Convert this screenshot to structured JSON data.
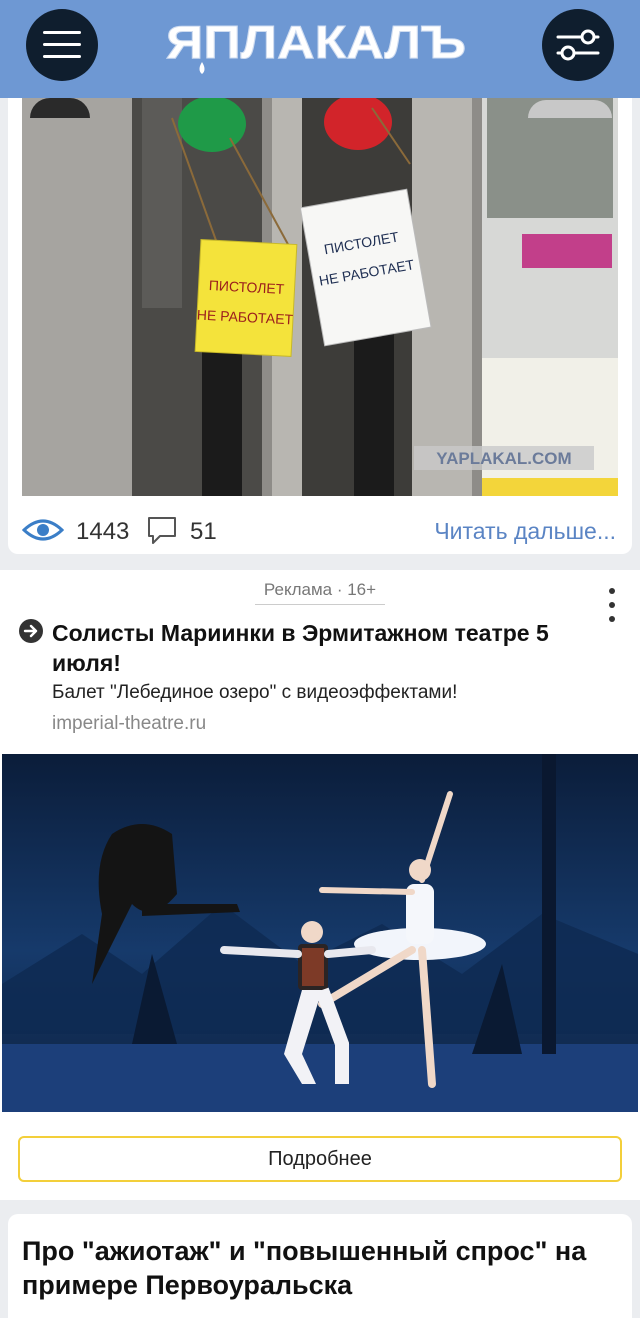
{
  "header": {
    "logo_text": "ЯПЛАКАЛЪ",
    "menu_icon": "hamburger-icon",
    "filter_icon": "sliders-icon",
    "bg_color": "#6e98d3"
  },
  "post": {
    "image_signs": [
      "ПИСТОЛЕТ",
      "НЕ РАБОТАЕТ",
      "ПИСТОЛЕТ",
      "НЕ РАБОТАЕТ"
    ],
    "watermark": "YAPLAKAL.COM",
    "views": "1443",
    "comments": "51",
    "read_more": "Читать дальше..."
  },
  "ad": {
    "label": "Реклама · 16+",
    "title": "Солисты Мариинки в Эрмитажном театре 5 июля!",
    "description": "Балет \"Лебединое озеро\" с видеоэффектами!",
    "domain": "imperial-theatre.ru",
    "cta": "Подробнее"
  },
  "next_post": {
    "title": "Про \"ажиотаж\" и \"повышенный спрос\" на примере Первоуральска"
  }
}
